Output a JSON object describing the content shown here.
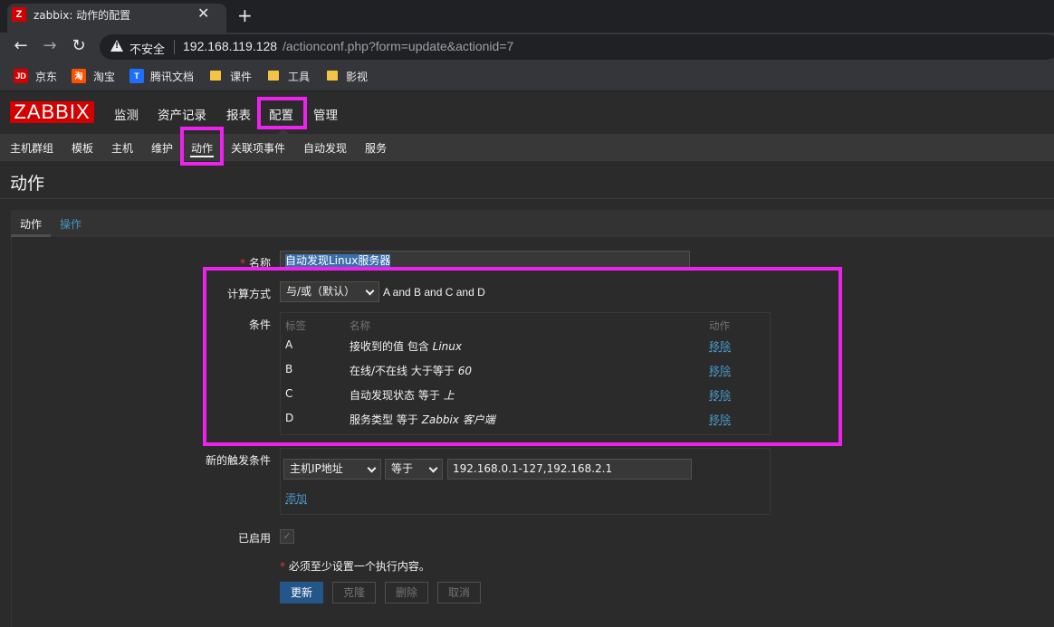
{
  "browser": {
    "tab_title": "zabbix: 动作的配置",
    "tab_favicon": "Z",
    "not_secure": "不安全",
    "url_host": "192.168.119.128",
    "url_path": "/actionconf.php?form=update&actionid=7",
    "bookmarks": [
      "京东",
      "淘宝",
      "腾讯文档",
      "课件",
      "工具",
      "影视"
    ]
  },
  "zabbix": {
    "logo": "ZABBIX",
    "main_nav": [
      "监测",
      "资产记录",
      "报表",
      "配置",
      "管理"
    ],
    "sub_nav": [
      "主机群组",
      "模板",
      "主机",
      "维护",
      "动作",
      "关联项事件",
      "自动发现",
      "服务"
    ],
    "page_title": "动作",
    "tabs": [
      "动作",
      "操作"
    ]
  },
  "form": {
    "name_label": "名称",
    "name_value": "自动发现Linux服务器",
    "calc_label": "计算方式",
    "calc_value": "与/或（默认）",
    "calc_formula": "A and B and C and D",
    "conditions_label": "条件",
    "conditions_headers": [
      "标签",
      "名称",
      "动作"
    ],
    "conditions": [
      {
        "tag": "A",
        "name": "接收到的值 包含 ",
        "value": "Linux",
        "action": "移除"
      },
      {
        "tag": "B",
        "name": "在线/不在线 大于等于 ",
        "value": "60",
        "action": "移除"
      },
      {
        "tag": "C",
        "name": "自动发现状态 等于 ",
        "value": "上",
        "action": "移除"
      },
      {
        "tag": "D",
        "name": "服务类型 等于 ",
        "value": "Zabbix 客户端",
        "action": "移除"
      }
    ],
    "new_condition_label": "新的触发条件",
    "new_condition_type": "主机IP地址",
    "new_condition_op": "等于",
    "new_condition_value": "192.168.0.1-127,192.168.2.1",
    "add_link": "添加",
    "enabled_label": "已启用",
    "note": "必须至少设置一个执行内容。",
    "buttons": [
      "更新",
      "克隆",
      "删除",
      "取消"
    ]
  },
  "colors": {
    "highlight": "#ee22ee",
    "zabbix_red": "#d40000",
    "link": "#4796c4",
    "primary_button": "#24568a"
  }
}
